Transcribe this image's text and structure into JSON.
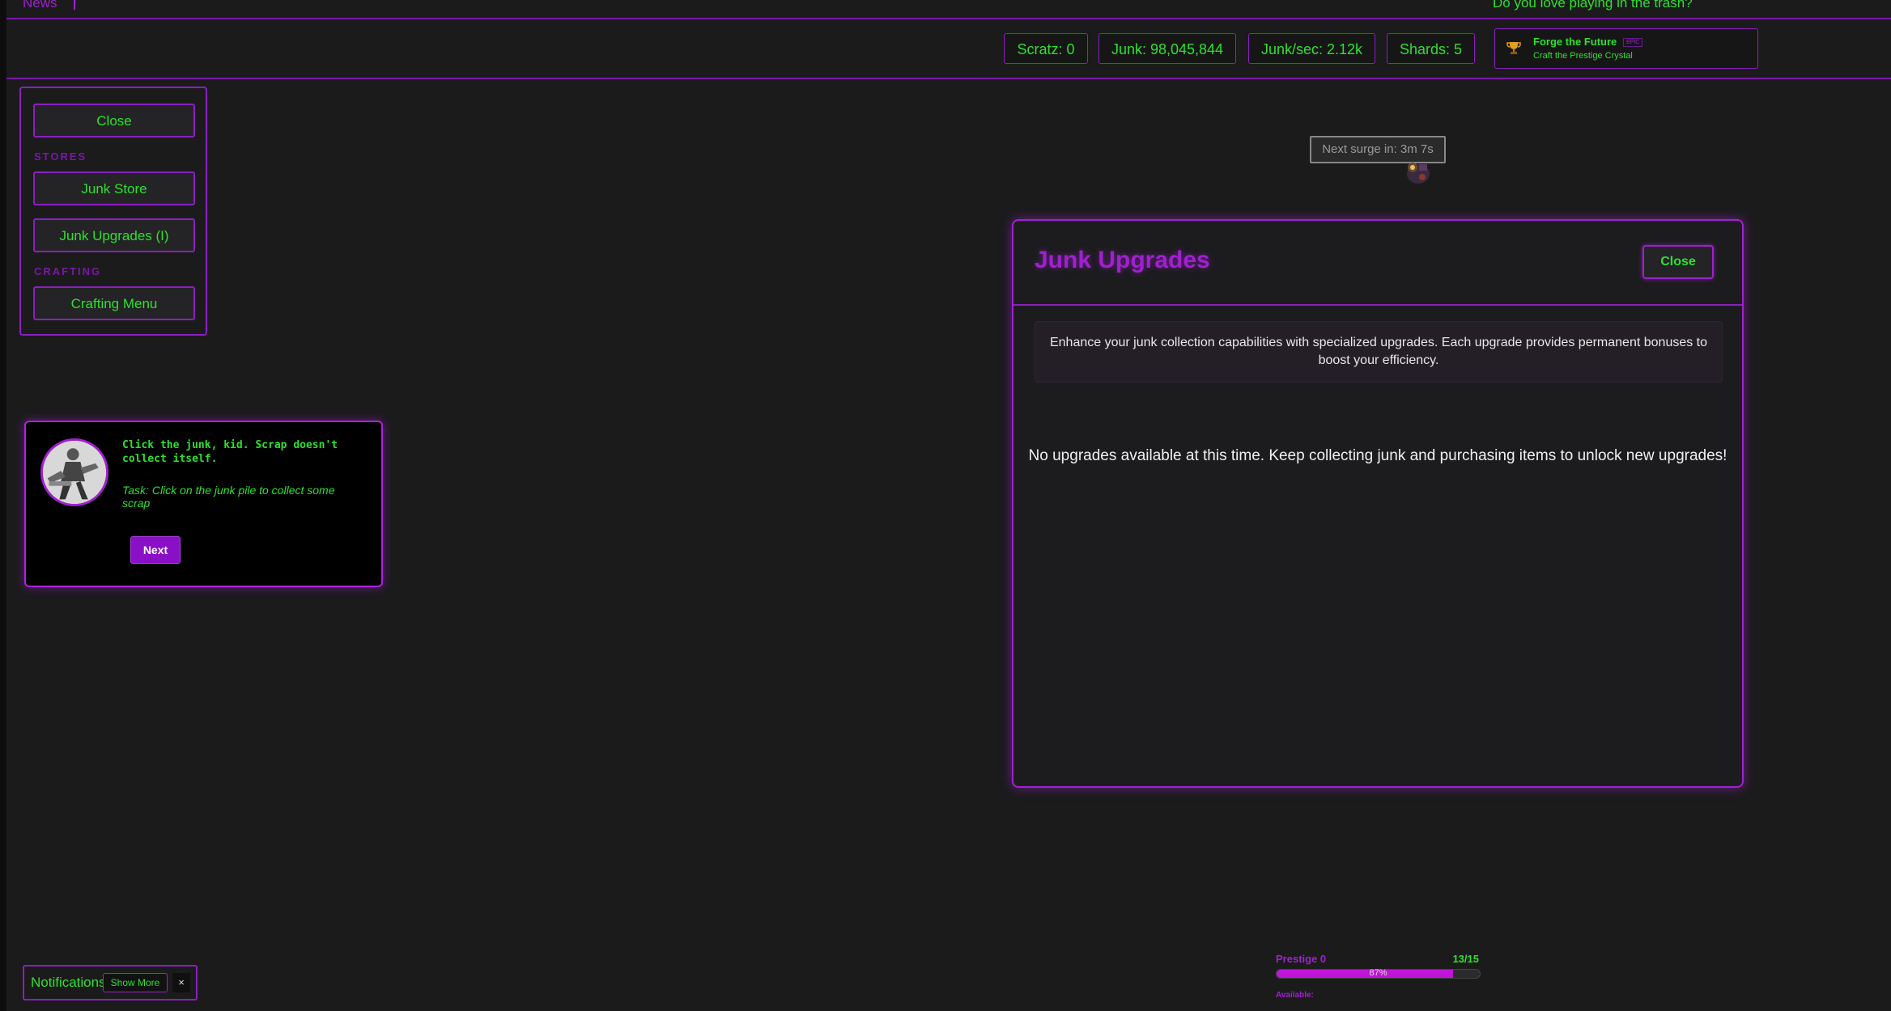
{
  "news": {
    "label": "News",
    "ticker": "Do you love playing in the trash?"
  },
  "stats": [
    {
      "label": "Scratz: 0"
    },
    {
      "label": "Junk: 98,045,844"
    },
    {
      "label": "Junk/sec: 2.12k"
    },
    {
      "label": "Shards: 5"
    }
  ],
  "achievement": {
    "title": "Forge the Future",
    "badge": "EPIC",
    "description": "Craft the Prestige Crystal",
    "icon": "trophy-icon"
  },
  "sidebar": {
    "close_label": "Close",
    "stores_heading": "STORES",
    "junk_store_label": "Junk Store",
    "junk_upgrades_label": "Junk Upgrades (I)",
    "crafting_heading": "CRAFTING",
    "crafting_menu_label": "Crafting Menu"
  },
  "surge": {
    "label": "Next surge in: 3m 7s"
  },
  "tutorial": {
    "message": "Click the junk, kid. Scrap doesn't collect itself.",
    "task": "Task: Click on the junk pile to collect some scrap",
    "next_label": "Next"
  },
  "modal": {
    "title": "Junk Upgrades",
    "close_label": "Close",
    "description": "Enhance your junk collection capabilities with specialized upgrades. Each upgrade provides permanent bonuses to boost your efficiency.",
    "empty_message": "No upgrades available at this time. Keep collecting junk and purchasing items to unlock new upgrades!"
  },
  "notifications": {
    "label": "Notifications",
    "show_more_label": "Show More",
    "close_label": "×"
  },
  "prestige": {
    "label": "Prestige 0",
    "count": "13/15",
    "percent_label": "87%",
    "progress": 0.87,
    "available_label": "Available:"
  },
  "colors": {
    "accent": "#a020d0",
    "text_green": "#2ee02e",
    "background": "#1b1b1c"
  }
}
